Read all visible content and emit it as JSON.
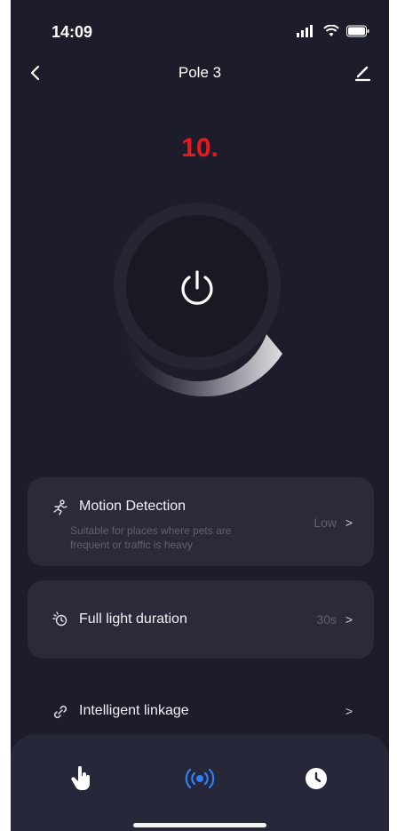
{
  "status_bar": {
    "time": "14:09"
  },
  "header": {
    "title": "Pole 3"
  },
  "step_label": "10.",
  "cards": {
    "motion": {
      "title": "Motion Detection",
      "subtitle_line1": "Suitable for places where pets are",
      "subtitle_line2": "frequent or traffic is heavy",
      "value": "Low",
      "chevron": ">"
    },
    "full_light": {
      "title": "Full light duration",
      "value": "30s",
      "chevron": ">"
    },
    "linkage": {
      "title": "Intelligent linkage",
      "chevron": ">"
    }
  },
  "tabs": [
    {
      "icon": "hand-pointer-icon",
      "active": false
    },
    {
      "icon": "signal-broadcast-icon",
      "active": true
    },
    {
      "icon": "clock-icon",
      "active": false
    }
  ],
  "colors": {
    "background": "#1c1c2b",
    "card": "#2a2a3a",
    "accent": "#2f7ff5",
    "step_label": "#e8181c",
    "muted_text": "#5f6072"
  }
}
